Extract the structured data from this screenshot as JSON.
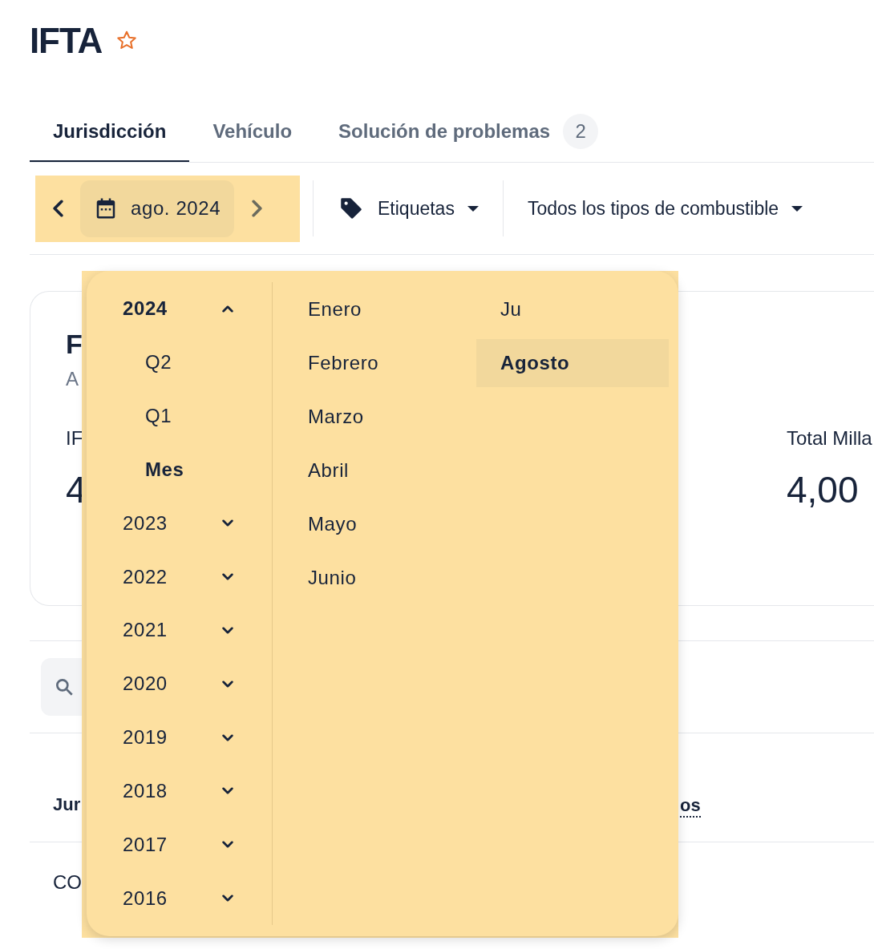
{
  "title": "IFTA",
  "favorite": false,
  "tabs": [
    {
      "label": "Jurisdicción",
      "selected": true
    },
    {
      "label": "Vehículo",
      "selected": false
    },
    {
      "label": "Solución de problemas",
      "selected": false,
      "badge": "2"
    }
  ],
  "toolbar": {
    "date_value": "ago. 2024",
    "tags_label": "Etiquetas",
    "fuel_label": "Todos los tipos de combustible"
  },
  "card": {
    "title": "F",
    "subtitle": "A",
    "metrics": [
      {
        "label": "IF",
        "value": "4"
      },
      {
        "label": "Total Milla",
        "value": "4,00"
      }
    ]
  },
  "table": {
    "columns": [
      {
        "label": "Jur",
        "kind": "plain"
      },
      {
        "label": "os",
        "kind": "tooltip"
      }
    ],
    "rows": [
      [
        "CO"
      ]
    ]
  },
  "period_menu": {
    "years": [
      {
        "label": "2024",
        "expanded": true,
        "children": [
          {
            "label": "Q2",
            "selected": false
          },
          {
            "label": "Q1",
            "selected": false
          },
          {
            "label": "Mes",
            "selected": true
          }
        ]
      },
      {
        "label": "2023",
        "expanded": false
      },
      {
        "label": "2022",
        "expanded": false
      },
      {
        "label": "2021",
        "expanded": false
      },
      {
        "label": "2020",
        "expanded": false
      },
      {
        "label": "2019",
        "expanded": false
      },
      {
        "label": "2018",
        "expanded": false
      },
      {
        "label": "2017",
        "expanded": false
      },
      {
        "label": "2016",
        "expanded": false
      }
    ],
    "months": [
      {
        "label": "Enero",
        "selected": false
      },
      {
        "label": "Febrero",
        "selected": false
      },
      {
        "label": "Marzo",
        "selected": false
      },
      {
        "label": "Abril",
        "selected": false
      },
      {
        "label": "Mayo",
        "selected": false
      },
      {
        "label": "Junio",
        "selected": false
      },
      {
        "label": "Ju",
        "selected": false
      },
      {
        "label": "Agosto",
        "selected": true
      }
    ]
  }
}
